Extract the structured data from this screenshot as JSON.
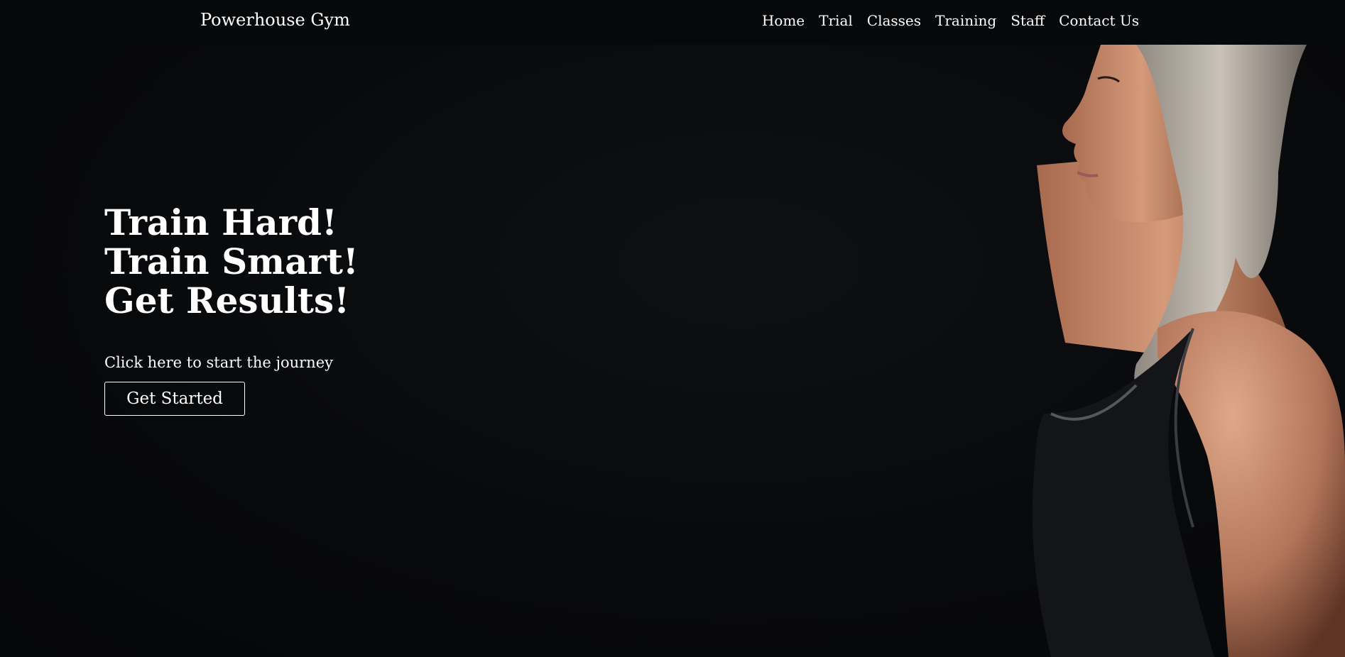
{
  "nav": {
    "brand": "Powerhouse Gym",
    "links": [
      "Home",
      "Trial",
      "Classes",
      "Training",
      "Staff",
      "Contact Us"
    ]
  },
  "hero": {
    "headline": [
      "Train Hard!",
      "Train Smart!",
      "Get Results!"
    ],
    "caption": "Click here to start the journey",
    "button_label": "Get Started",
    "image": "woman-athlete-profile-photo"
  },
  "colors": {
    "background": "#08090b",
    "text": "#ffffff",
    "skin": "#c98a6a",
    "hair": "#b9b2a8",
    "top": "#141518"
  }
}
